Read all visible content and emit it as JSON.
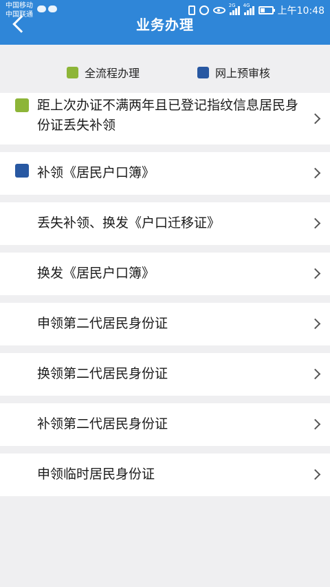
{
  "status_bar": {
    "carrier_1": "中国移动",
    "carrier_2": "中国联通",
    "sig1_label": "2G",
    "sig2_label": "4G",
    "time": "上午10:48"
  },
  "header": {
    "title": "业务办理"
  },
  "legend": [
    {
      "label": "全流程办理",
      "color": "#8db538"
    },
    {
      "label": "网上预审核",
      "color": "#2858a2"
    }
  ],
  "items": [
    {
      "label": "距上次办证不满两年且已登记指纹信息居民身份证丢失补领",
      "marker": "#8db538"
    },
    {
      "label": "补领《居民户口簿》",
      "marker": "#2858a2"
    },
    {
      "label": "丢失补领、换发《户口迁移证》",
      "marker": ""
    },
    {
      "label": "换发《居民户口簿》",
      "marker": ""
    },
    {
      "label": "申领第二代居民身份证",
      "marker": ""
    },
    {
      "label": "换领第二代居民身份证",
      "marker": ""
    },
    {
      "label": "补领第二代居民身份证",
      "marker": ""
    },
    {
      "label": "申领临时居民身份证",
      "marker": ""
    }
  ]
}
